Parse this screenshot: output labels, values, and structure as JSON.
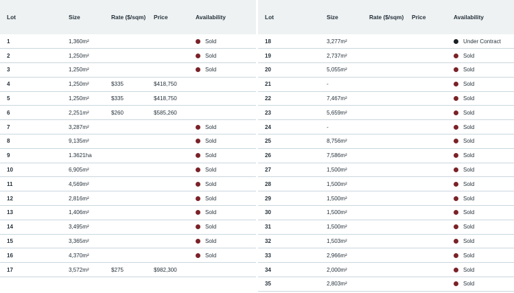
{
  "headers": {
    "lot": "Lot",
    "size": "Size",
    "rate": "Rate ($/sqm)",
    "price": "Price",
    "availability": "Availability"
  },
  "status_colors": {
    "Sold": "#7a2228",
    "Under Contract": "#1b2126"
  },
  "left_rows": [
    {
      "lot": "1",
      "size": "1,360m²",
      "rate": "",
      "price": "",
      "status": "Sold"
    },
    {
      "lot": "2",
      "size": "1,250m²",
      "rate": "",
      "price": "",
      "status": "Sold"
    },
    {
      "lot": "3",
      "size": "1,250m²",
      "rate": "",
      "price": "",
      "status": "Sold"
    },
    {
      "lot": "4",
      "size": "1,250m²",
      "rate": "$335",
      "price": "$418,750",
      "status": ""
    },
    {
      "lot": "5",
      "size": "1,250m²",
      "rate": "$335",
      "price": "$418,750",
      "status": ""
    },
    {
      "lot": "6",
      "size": "2,251m²",
      "rate": "$260",
      "price": "$585,260",
      "status": ""
    },
    {
      "lot": "7",
      "size": "3,287m²",
      "rate": "",
      "price": "",
      "status": "Sold"
    },
    {
      "lot": "8",
      "size": "9,135m²",
      "rate": "",
      "price": "",
      "status": "Sold"
    },
    {
      "lot": "9",
      "size": "1.3621ha",
      "rate": "",
      "price": "",
      "status": "Sold"
    },
    {
      "lot": "10",
      "size": "6,905m²",
      "rate": "",
      "price": "",
      "status": "Sold"
    },
    {
      "lot": "11",
      "size": "4,569m²",
      "rate": "",
      "price": "",
      "status": "Sold"
    },
    {
      "lot": "12",
      "size": "2,816m²",
      "rate": "",
      "price": "",
      "status": "Sold"
    },
    {
      "lot": "13",
      "size": "1,406m²",
      "rate": "",
      "price": "",
      "status": "Sold"
    },
    {
      "lot": "14",
      "size": "3,495m²",
      "rate": "",
      "price": "",
      "status": "Sold"
    },
    {
      "lot": "15",
      "size": "3,365m²",
      "rate": "",
      "price": "",
      "status": "Sold"
    },
    {
      "lot": "16",
      "size": "4,370m²",
      "rate": "",
      "price": "",
      "status": "Sold"
    },
    {
      "lot": "17",
      "size": "3,572m²",
      "rate": "$275",
      "price": "$982,300",
      "status": ""
    }
  ],
  "right_rows": [
    {
      "lot": "18",
      "size": "3,277m²",
      "rate": "",
      "price": "",
      "status": "Under Contract"
    },
    {
      "lot": "19",
      "size": "2,737m²",
      "rate": "",
      "price": "",
      "status": "Sold"
    },
    {
      "lot": "20",
      "size": "5,055m²",
      "rate": "",
      "price": "",
      "status": "Sold"
    },
    {
      "lot": "21",
      "size": "-",
      "rate": "",
      "price": "",
      "status": "Sold"
    },
    {
      "lot": "22",
      "size": "7,467m²",
      "rate": "",
      "price": "",
      "status": "Sold"
    },
    {
      "lot": "23",
      "size": "5,659m²",
      "rate": "",
      "price": "",
      "status": "Sold"
    },
    {
      "lot": "24",
      "size": "-",
      "rate": "",
      "price": "",
      "status": "Sold"
    },
    {
      "lot": "25",
      "size": "8,756m²",
      "rate": "",
      "price": "",
      "status": "Sold"
    },
    {
      "lot": "26",
      "size": "7,586m²",
      "rate": "",
      "price": "",
      "status": "Sold"
    },
    {
      "lot": "27",
      "size": "1,500m²",
      "rate": "",
      "price": "",
      "status": "Sold"
    },
    {
      "lot": "28",
      "size": "1,500m²",
      "rate": "",
      "price": "",
      "status": "Sold"
    },
    {
      "lot": "29",
      "size": "1,500m²",
      "rate": "",
      "price": "",
      "status": "Sold"
    },
    {
      "lot": "30",
      "size": "1,500m²",
      "rate": "",
      "price": "",
      "status": "Sold"
    },
    {
      "lot": "31",
      "size": "1,500m²",
      "rate": "",
      "price": "",
      "status": "Sold"
    },
    {
      "lot": "32",
      "size": "1,503m²",
      "rate": "",
      "price": "",
      "status": "Sold"
    },
    {
      "lot": "33",
      "size": "2,966m²",
      "rate": "",
      "price": "",
      "status": "Sold"
    },
    {
      "lot": "34",
      "size": "2,000m²",
      "rate": "",
      "price": "",
      "status": "Sold"
    },
    {
      "lot": "35",
      "size": "2,803m²",
      "rate": "",
      "price": "",
      "status": "Sold"
    }
  ]
}
